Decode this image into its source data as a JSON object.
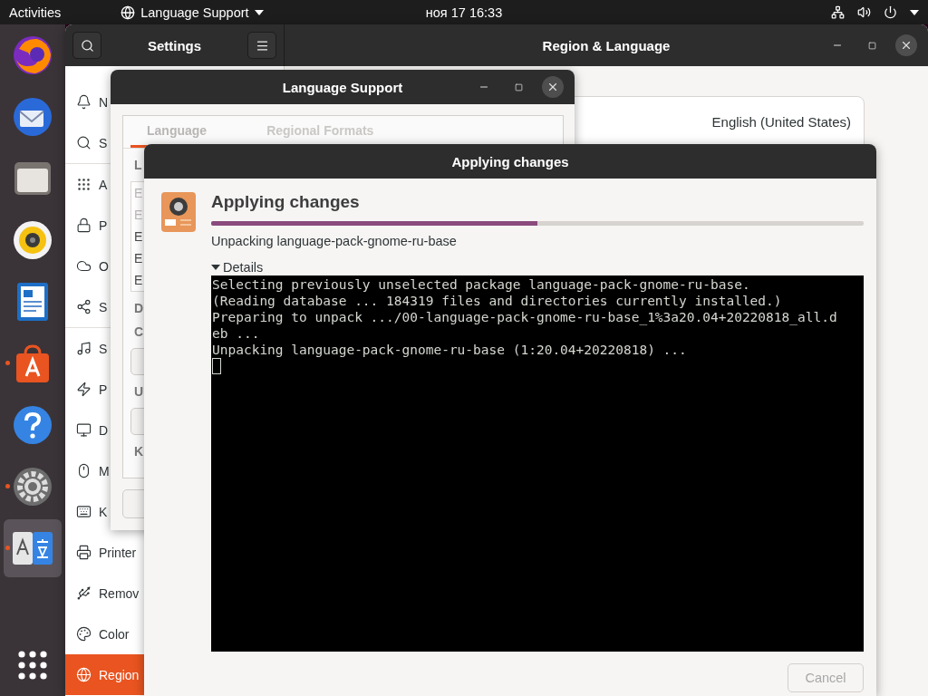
{
  "top_bar": {
    "activities": "Activities",
    "app_menu": "Language Support",
    "clock": "ноя 17  16:33"
  },
  "dock": [
    {
      "kind": "browser",
      "running": false,
      "selected": false
    },
    {
      "kind": "mail",
      "running": false,
      "selected": false
    },
    {
      "kind": "files",
      "running": false,
      "selected": false
    },
    {
      "kind": "music",
      "running": false,
      "selected": false
    },
    {
      "kind": "writer",
      "running": false,
      "selected": false
    },
    {
      "kind": "store",
      "running": true,
      "selected": false
    },
    {
      "kind": "help",
      "running": false,
      "selected": false
    },
    {
      "kind": "settings",
      "running": true,
      "selected": false
    },
    {
      "kind": "language",
      "running": true,
      "selected": true
    },
    {
      "kind": "grid",
      "running": false,
      "selected": false
    }
  ],
  "settings_window": {
    "sidebar_title": "Settings",
    "title": "Region & Language",
    "sidebar": {
      "groups": [
        [
          {
            "kind": "bell",
            "label": "N",
            "selected": false
          },
          {
            "kind": "search",
            "label": "S",
            "selected": false
          }
        ],
        [
          {
            "kind": "apps",
            "label": "A",
            "selected": false
          },
          {
            "kind": "lock",
            "label": "P",
            "selected": false
          },
          {
            "kind": "cloud",
            "label": "O",
            "selected": false
          },
          {
            "kind": "share",
            "label": "S",
            "selected": false
          }
        ],
        [
          {
            "kind": "music",
            "label": "S",
            "selected": false
          },
          {
            "kind": "power",
            "label": "P",
            "selected": false
          },
          {
            "kind": "display",
            "label": "D",
            "selected": false
          },
          {
            "kind": "mouse",
            "label": "M",
            "selected": false
          },
          {
            "kind": "keyboard",
            "label": "K",
            "selected": false
          },
          {
            "kind": "printer",
            "label": "Printer",
            "selected": false
          },
          {
            "kind": "usb",
            "label": "Remov",
            "selected": false
          },
          {
            "kind": "color",
            "label": "Color",
            "selected": false
          },
          {
            "kind": "globe",
            "label": "Region",
            "selected": true
          }
        ]
      ]
    },
    "language_value": "English (United States)"
  },
  "language_support_window": {
    "title": "Language Support",
    "tabs": [
      {
        "label": "Language",
        "selected": true
      },
      {
        "label": "Regional Formats",
        "selected": false
      }
    ],
    "content": [
      {
        "kind": "label",
        "text": "L"
      },
      {
        "kind": "list",
        "items": [
          {
            "text": "E",
            "disabled": true
          },
          {
            "text": "E",
            "disabled": true
          },
          {
            "text": "E",
            "disabled": false
          },
          {
            "text": "E",
            "disabled": false
          },
          {
            "text": "E",
            "disabled": false
          }
        ]
      },
      {
        "kind": "label",
        "text": "D"
      },
      {
        "kind": "label",
        "text": "C"
      },
      {
        "kind": "combo"
      },
      {
        "kind": "label",
        "text": "U"
      },
      {
        "kind": "combo"
      },
      {
        "kind": "label",
        "text": "K"
      }
    ]
  },
  "dialog": {
    "title": "Applying changes",
    "heading": "Applying changes",
    "progress": {
      "level": 0.5
    },
    "status": "Unpacking language-pack-gnome-ru-base",
    "details": {
      "label": "Details",
      "expanded": true,
      "terminal_lines": [
        "Selecting previously unselected package language-pack-gnome-ru-base.",
        "(Reading database ... 184319 files and directories currently installed.)",
        "Preparing to unpack .../00-language-pack-gnome-ru-base_1%3a20.04+20220818_all.d",
        "eb ...",
        "Unpacking language-pack-gnome-ru-base (1:20.04+20220818) ..."
      ]
    },
    "cancel": {
      "label": "Cancel",
      "disabled": true
    }
  }
}
